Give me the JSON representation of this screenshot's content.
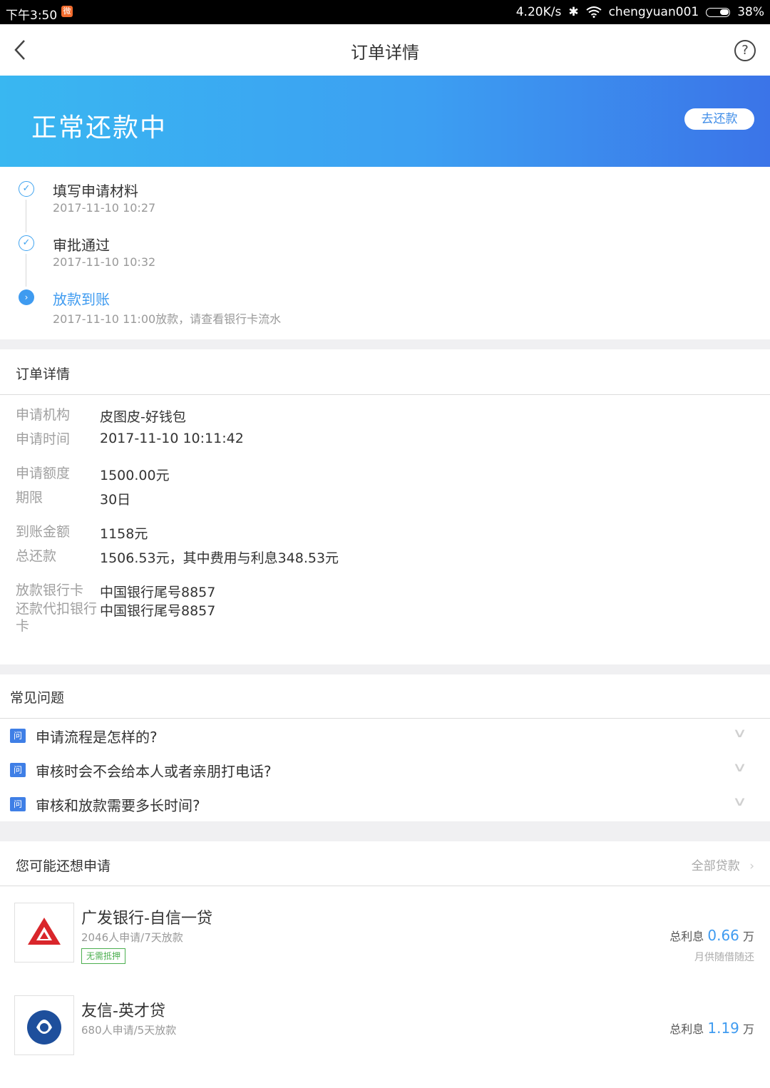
{
  "status_bar": {
    "time": "下午3:50",
    "speed": "4.20K/s",
    "bluetooth": "✱",
    "network_name": "chengyuan001",
    "battery": "38%"
  },
  "nav": {
    "title": "订单详情",
    "back_icon": "chevron-left-icon",
    "help_icon": "question-circle-icon",
    "help_glyph": "?"
  },
  "banner": {
    "status": "正常还款中",
    "action": "去还款"
  },
  "timeline": {
    "steps": [
      {
        "title": "填写申请材料",
        "time": "2017-11-10 10:27",
        "state": "done"
      },
      {
        "title": "审批通过",
        "time": "2017-11-10 10:32",
        "state": "done"
      },
      {
        "title": "放款到账",
        "time": "2017-11-10 11:00放款，请查看银行卡流水",
        "state": "current"
      }
    ]
  },
  "details": {
    "section_title": "订单详情",
    "rows": [
      {
        "label": "申请机构",
        "value": "皮图皮-好钱包"
      },
      {
        "label": "申请时间",
        "value": "2017-11-10 10:11:42"
      },
      {
        "label": "申请额度",
        "value": "1500.00元"
      },
      {
        "label": "期限",
        "value": "30日"
      },
      {
        "label": "到账金额",
        "value": "1158元"
      },
      {
        "label": "总还款",
        "value": "1506.53元，其中费用与利息348.53元"
      },
      {
        "label": "放款银行卡",
        "value": "中国银行尾号8857"
      },
      {
        "label": "还款代扣银行卡",
        "value": "中国银行尾号8857"
      }
    ]
  },
  "faq": {
    "section_title": "常见问题",
    "badge": "问",
    "items": [
      "申请流程是怎样的?",
      "审核时会不会给本人或者亲朋打电话?",
      "审核和放款需要多长时间?"
    ]
  },
  "recommend": {
    "section_title": "您可能还想申请",
    "more": "全部贷款",
    "items": [
      {
        "name": "广发银行-自信一贷",
        "sub": "2046人申请/7天放款",
        "tag": "无需抵押",
        "rate_label": "总利息",
        "rate_value": "0.66",
        "rate_unit": "万",
        "note": "月供随借随还",
        "logo_color": "#d9262b"
      },
      {
        "name": "友信-英才贷",
        "sub": "680人申请/5天放款",
        "rate_label": "总利息",
        "rate_value": "1.19",
        "rate_unit": "万",
        "logo_color": "#1e4f9c"
      }
    ]
  },
  "colors": {
    "accent": "#3f9bf0",
    "banner_start": "#39b7f1",
    "banner_end": "#3b74e8",
    "tag_green": "#4caf50"
  }
}
